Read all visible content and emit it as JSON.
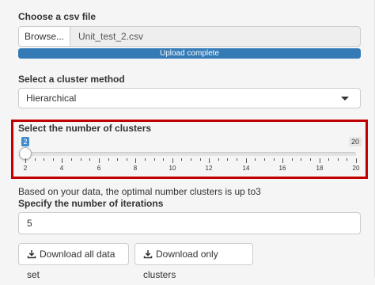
{
  "file_upload": {
    "label": "Choose a csv file",
    "browse_label": "Browse...",
    "file_name": "Unit_test_2.csv",
    "progress_text": "Upload complete",
    "progress_value": 1.0,
    "progress_color": "#337ab7"
  },
  "cluster_method": {
    "label": "Select a cluster method",
    "selected": "Hierarchical"
  },
  "cluster_count": {
    "label": "Select the number of clusters",
    "value": 2,
    "value_label": "2",
    "min": 2,
    "max": 20,
    "max_label": "20",
    "ticks": [
      "2",
      "4",
      "6",
      "8",
      "10",
      "12",
      "14",
      "16",
      "18",
      "20"
    ],
    "highlight_color": "#c00000",
    "badge_color": "#428bca"
  },
  "info_text": "Based on your data, the optimal number clusters is up to3",
  "iterations": {
    "label": "Specify the number of iterations",
    "value": "5"
  },
  "buttons": {
    "download_all_label": "Download all data set",
    "download_clusters_label": "Download only clusters"
  }
}
